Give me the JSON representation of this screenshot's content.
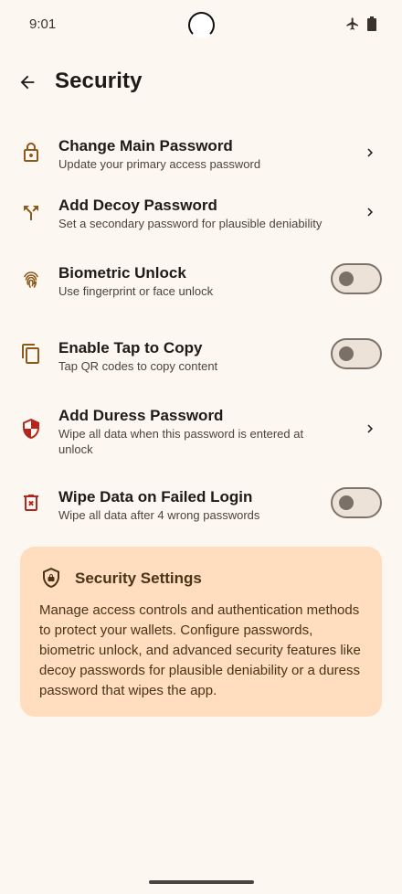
{
  "status_bar": {
    "time": "9:01"
  },
  "header": {
    "title": "Security"
  },
  "items": [
    {
      "title": "Change Main Password",
      "subtitle": "Update your primary access password",
      "control": "chevron",
      "icon": "lock-icon"
    },
    {
      "title": "Add Decoy Password",
      "subtitle": "Set a secondary password for plausible deniability",
      "control": "chevron",
      "icon": "split-arrows-icon"
    },
    {
      "title": "Biometric Unlock",
      "subtitle": "Use fingerprint or face unlock",
      "control": "toggle",
      "checked": false,
      "icon": "fingerprint-icon"
    },
    {
      "title": "Enable Tap to Copy",
      "subtitle": "Tap QR codes to copy content",
      "control": "toggle",
      "checked": false,
      "icon": "copy-icon"
    },
    {
      "title": "Add Duress Password",
      "subtitle": "Wipe all data when this password is entered at unlock",
      "control": "chevron",
      "icon": "shield-icon"
    },
    {
      "title": "Wipe Data on Failed Login",
      "subtitle": "Wipe all data after 4 wrong passwords",
      "control": "toggle",
      "checked": false,
      "icon": "delete-icon"
    }
  ],
  "info_card": {
    "title": "Security Settings",
    "body": "Manage access controls and authentication methods to protect your wallets. Configure passwords, biometric unlock, and advanced security features like decoy passwords for plausible deniability or a duress password that wipes the app.",
    "icon": "shield-lock-icon"
  },
  "colors": {
    "background": "#FDF7F2",
    "accent_brown": "#8B5A1B",
    "danger_red": "#B3261E",
    "card_background": "#FFDDBE"
  }
}
